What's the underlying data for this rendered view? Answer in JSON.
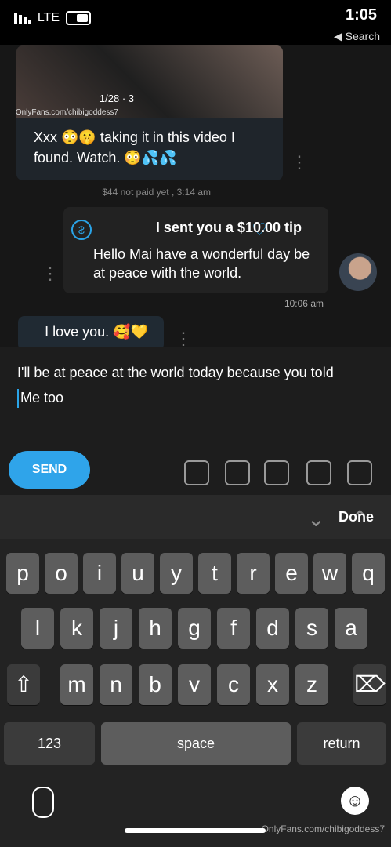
{
  "status": {
    "time": "1:05",
    "back": "◀ Search",
    "network": "LTE"
  },
  "chat": {
    "media_meta": "1/28 · 3",
    "watermark": "OnlyFans.com/chibigoddess7",
    "media_caption": "Xxx 😳🤫 taking it in this video I found. Watch. 😳💦💦",
    "paid_note": "$44 not paid yet , 3:14 am",
    "tip_title": "I sent you a $10.00 tip",
    "tip_message": "Hello Mai have a wonderful day be at peace with the world.",
    "time2": "10:06 am",
    "last_message": "I love you. 🥰💛"
  },
  "composer": {
    "line1": "I'll be at peace at the world today because you told",
    "line2": "Me too",
    "send": "SEND"
  },
  "keyboard": {
    "done": "Done",
    "row1": [
      "q",
      "w",
      "e",
      "r",
      "t",
      "y",
      "u",
      "i",
      "o",
      "p"
    ],
    "row2": [
      "a",
      "s",
      "d",
      "f",
      "g",
      "h",
      "j",
      "k",
      "l"
    ],
    "row3": [
      "z",
      "x",
      "c",
      "v",
      "b",
      "n",
      "m"
    ],
    "return": "return",
    "space": "space",
    "numbers": "123"
  },
  "footer": {
    "watermark": "OnlyFans.com/chibigoddess7"
  }
}
